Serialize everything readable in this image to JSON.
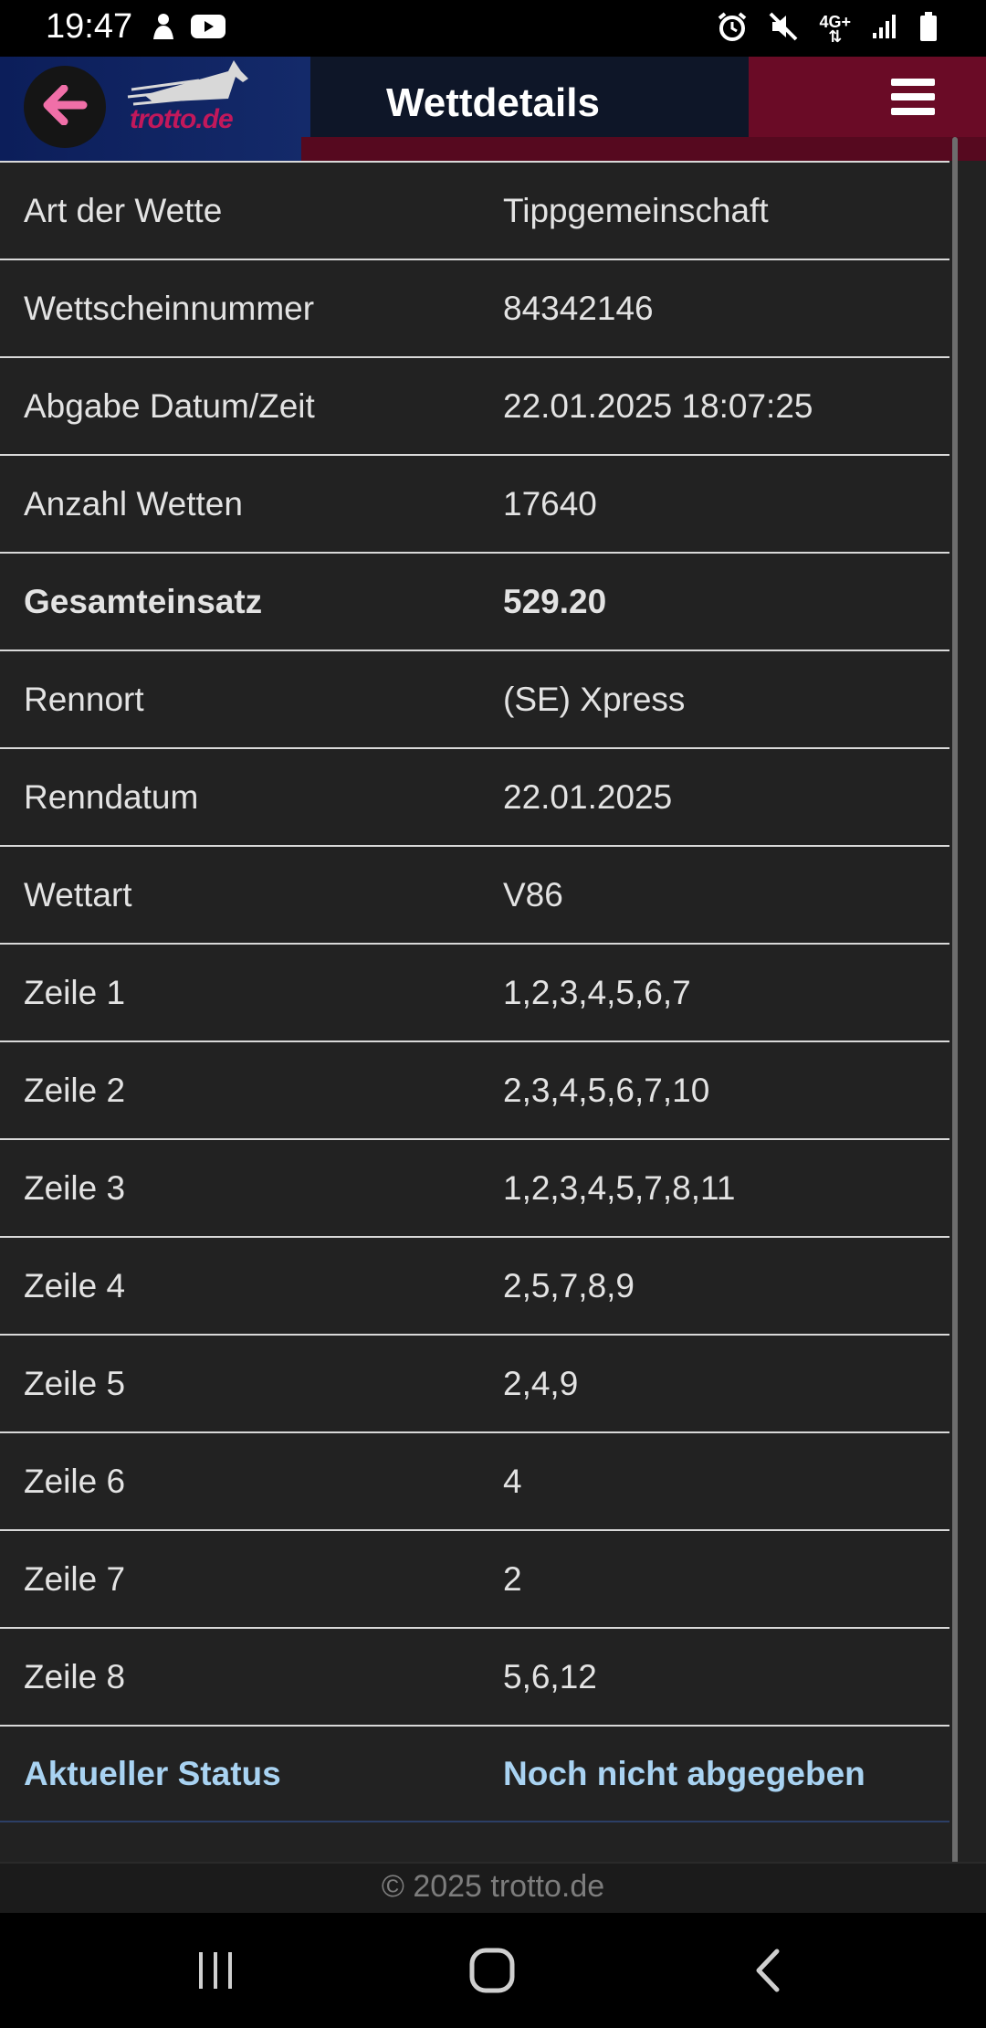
{
  "status_bar": {
    "time": "19:47",
    "left_icons": [
      "person-icon",
      "youtube-icon"
    ],
    "right_icons": [
      "alarm-icon",
      "mute-icon",
      "4g-icon",
      "signal-icon",
      "battery-icon"
    ],
    "network": "4G+"
  },
  "header": {
    "title": "Wettdetails",
    "logo_text": "trotto.de",
    "back_icon": "arrow-left-icon",
    "menu_icon": "hamburger-icon",
    "colors": {
      "back_arrow": "#f06fa8",
      "logo": "#c2185b",
      "red_accent": "#6a0b26",
      "blue_accent": "#0c1e5a"
    }
  },
  "details": [
    {
      "label": "Art der Wette",
      "value": "Tippgemeinschaft"
    },
    {
      "label": "Wettscheinnummer",
      "value": "84342146"
    },
    {
      "label": "Abgabe Datum/Zeit",
      "value": "22.01.2025 18:07:25"
    },
    {
      "label": "Anzahl Wetten",
      "value": "17640"
    },
    {
      "label": "Gesamteinsatz",
      "value": "529.20"
    },
    {
      "label": "Rennort",
      "value": "(SE) Xpress"
    },
    {
      "label": "Renndatum",
      "value": "22.01.2025"
    },
    {
      "label": "Wettart",
      "value": "V86"
    },
    {
      "label": "Zeile 1",
      "value": "1,2,3,4,5,6,7"
    },
    {
      "label": "Zeile 2",
      "value": "2,3,4,5,6,7,10"
    },
    {
      "label": "Zeile 3",
      "value": "1,2,3,4,5,7,8,11"
    },
    {
      "label": "Zeile 4",
      "value": "2,5,7,8,9"
    },
    {
      "label": "Zeile 5",
      "value": "2,4,9"
    },
    {
      "label": "Zeile 6",
      "value": "4"
    },
    {
      "label": "Zeile 7",
      "value": "2"
    },
    {
      "label": "Zeile 8",
      "value": "5,6,12"
    },
    {
      "label": "Aktueller Status",
      "value": "Noch nicht abgegeben"
    }
  ],
  "footer": {
    "copyright": "© 2025 trotto.de"
  },
  "nav_bar": {
    "icons": [
      "recent-apps-icon",
      "home-icon",
      "back-icon"
    ]
  }
}
